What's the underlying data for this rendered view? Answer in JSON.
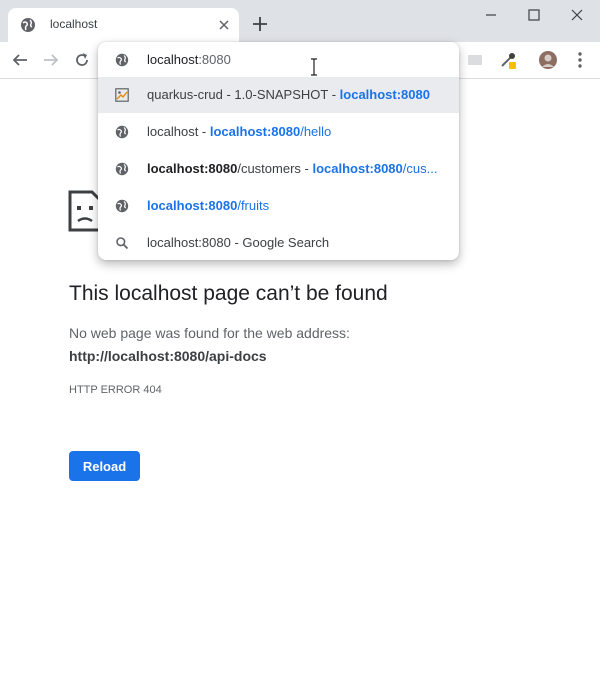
{
  "tab": {
    "title": "localhost"
  },
  "omnibox": {
    "typed": "localhost",
    "autocomplete": ":8080",
    "suggestions": [
      {
        "icon": "quarkus-favicon",
        "selected": true,
        "parts": [
          {
            "t": "quarkus-crud - 1.0-SNAPSHOT - ",
            "s": ""
          },
          {
            "t": "localhost:8080",
            "s": "hl"
          }
        ]
      },
      {
        "icon": "globe-icon",
        "selected": false,
        "parts": [
          {
            "t": "localhost - ",
            "s": ""
          },
          {
            "t": "localhost:8080",
            "s": "hl"
          },
          {
            "t": "/hello",
            "s": "bl"
          }
        ]
      },
      {
        "icon": "globe-icon",
        "selected": false,
        "parts": [
          {
            "t": "localhost:8080",
            "s": "bd"
          },
          {
            "t": "/customers - ",
            "s": ""
          },
          {
            "t": "localhost:8080",
            "s": "hl"
          },
          {
            "t": "/cus...",
            "s": "bl"
          }
        ]
      },
      {
        "icon": "globe-icon",
        "selected": false,
        "parts": [
          {
            "t": "localhost:8080",
            "s": "hl"
          },
          {
            "t": "/fruits",
            "s": "bl"
          }
        ]
      },
      {
        "icon": "search-icon",
        "selected": false,
        "parts": [
          {
            "t": "localhost:8080 - Google Search",
            "s": ""
          }
        ]
      }
    ]
  },
  "error": {
    "title": "This localhost page can’t be found",
    "description": "No web page was found for the web address:",
    "url": "http://localhost:8080/api-docs",
    "code": "HTTP ERROR 404",
    "reload_label": "Reload"
  },
  "colors": {
    "accent": "#1a73e8",
    "tabstrip": "#dee1e6",
    "selected_row": "#eaebee"
  }
}
